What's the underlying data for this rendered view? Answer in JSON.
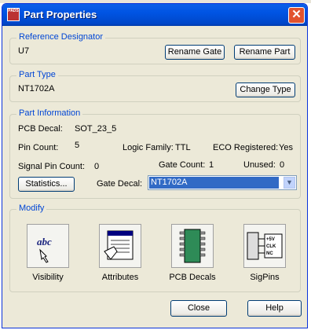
{
  "window": {
    "title": "Part Properties",
    "close_symbol": "✕",
    "icon_text": "PADS"
  },
  "reference_designator": {
    "label": "Reference Designator",
    "value": "U7",
    "rename_gate": "Rename Gate",
    "rename_part": "Rename Part"
  },
  "part_type": {
    "label": "Part Type",
    "value": "NT1702A",
    "change_type": "Change Type"
  },
  "part_information": {
    "label": "Part Information",
    "pcb_decal_label": "PCB Decal:",
    "pcb_decal_value": "SOT_23_5",
    "pin_count_label": "Pin Count:",
    "pin_count_value": "5",
    "logic_family_label": "Logic Family:",
    "logic_family_value": "TTL",
    "eco_registered_label": "ECO Registered:",
    "eco_registered_value": "Yes",
    "signal_pin_count_label": "Signal Pin Count:",
    "signal_pin_count_value": "0",
    "gate_count_label": "Gate Count:",
    "gate_count_value": "1",
    "unused_label": "Unused:",
    "unused_value": "0",
    "statistics_button": "Statistics...",
    "gate_decal_label": "Gate Decal:",
    "gate_decal_value": "NT1702A"
  },
  "modify": {
    "label": "Modify",
    "visibility": {
      "label": "Visibility",
      "icon_text": "abc"
    },
    "attributes": {
      "label": "Attributes"
    },
    "pcb_decals": {
      "label": "PCB Decals"
    },
    "sigpins": {
      "label": "SigPins",
      "icon_rows": [
        "+5V",
        "CLK",
        "NC"
      ]
    }
  },
  "footer": {
    "close": "Close",
    "help": "Help"
  },
  "colors": {
    "title_bar": "#0054e3",
    "dialog_bg": "#ece9d8",
    "group_label": "#0046d5",
    "selection": "#316ac5",
    "close_button": "#e2532f"
  }
}
